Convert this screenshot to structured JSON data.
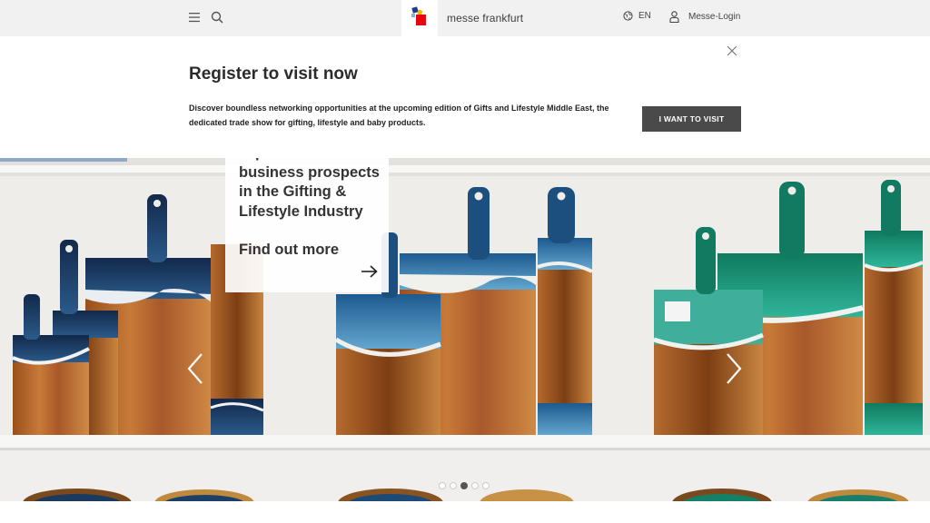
{
  "header": {
    "brand": "messe frankfurt",
    "language": "EN",
    "login_label": "Messe-Login"
  },
  "banner": {
    "title": "Register to visit now",
    "description": "Discover boundless networking opportunities at the upcoming edition of Gifts and Lifestyle Middle East, the dedicated trade show for gifting, lifestyle and baby products.",
    "button_label": "I WANT TO VISIT"
  },
  "hero": {
    "headline": "Tap into lucrative business prospects in the Gifting & Lifestyle Industry",
    "cta_label": "Find out more",
    "slides_count": 5,
    "active_slide": 3
  },
  "icons": {
    "menu": "menu-icon",
    "search": "search-icon",
    "globe": "globe-icon",
    "user": "user-icon",
    "close": "close-icon",
    "arrow_right": "arrow-right-icon",
    "chevron_left": "chevron-left-icon",
    "chevron_right": "chevron-right-icon"
  },
  "colors": {
    "topbar_bg": "#f1f1f1",
    "button_bg": "#4a4a4a",
    "logo_red": "#e30613",
    "logo_blue": "#1e3c8c"
  }
}
